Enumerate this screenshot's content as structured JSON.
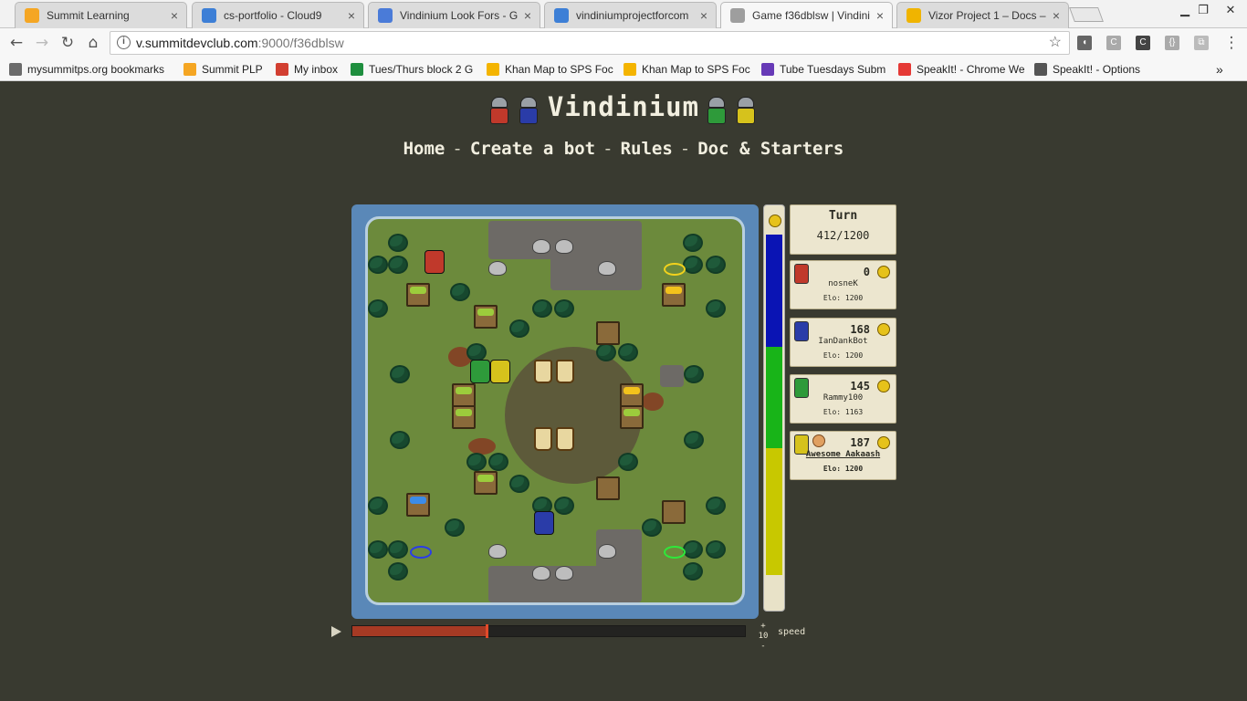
{
  "browser": {
    "tabs": [
      {
        "title": "Summit Learning",
        "icon": "sun-icon",
        "color": "#f5a623"
      },
      {
        "title": "cs-portfolio - Cloud9",
        "icon": "cloud9-icon",
        "color": "#3d7fd6"
      },
      {
        "title": "Vindinium Look Fors - Go",
        "icon": "google-docs-icon",
        "color": "#4a7bd8"
      },
      {
        "title": "vindiniumprojectforcom",
        "icon": "cloud9-icon",
        "color": "#3d7fd6"
      },
      {
        "title": "Game f36dblsw | Vindini",
        "icon": "page-icon",
        "color": "#9e9e9e"
      },
      {
        "title": "Vizor Project 1 – Docs –",
        "icon": "vizor-icon",
        "color": "#f0b400"
      }
    ],
    "close_glyph": "×",
    "url_host": "v.summitdevclub.com",
    "url_rest": ":9000/f36dblsw",
    "bookmarks": [
      {
        "label": "mysummitps.org bookmarks",
        "icon": "folder-icon",
        "color": "#6b6b6b"
      },
      {
        "label": "Summit PLP",
        "icon": "sun-icon",
        "color": "#f5a623"
      },
      {
        "label": "My inbox",
        "icon": "gmail-icon",
        "color": "#d23f31"
      },
      {
        "label": "Tues/Thurs block 2 G",
        "icon": "sheets-icon",
        "color": "#1e8e3e"
      },
      {
        "label": "Khan Map to SPS Foc",
        "icon": "drive-icon",
        "color": "#f4b400"
      },
      {
        "label": "Khan Map to SPS Foc",
        "icon": "drive-icon",
        "color": "#f4b400"
      },
      {
        "label": "Tube Tuesdays Subm",
        "icon": "forms-icon",
        "color": "#673ab7"
      },
      {
        "label": "SpeakIt! - Chrome We",
        "icon": "webstore-icon",
        "color": "#e53935"
      },
      {
        "label": "SpeakIt! - Options",
        "icon": "speaker-icon",
        "color": "#555555"
      }
    ],
    "more_bookmarks": "»"
  },
  "site": {
    "title": "Vindinium",
    "nav": [
      "Home",
      "Create a bot",
      "Rules",
      "Doc & Starters"
    ],
    "nav_sep": "-"
  },
  "game": {
    "turn_label": "Turn",
    "turn": "412/1200",
    "turn_fraction": 0.343,
    "players": [
      {
        "name": "nosneK",
        "gold": "0",
        "elo": "Elo: 1200",
        "color": "#c0392b",
        "icon": "crashed-bot-icon",
        "leader": false
      },
      {
        "name": "IanDankBot",
        "gold": "168",
        "elo": "Elo: 1200",
        "color": "#2a3ca8",
        "icon": "blue-hero-icon",
        "leader": false
      },
      {
        "name": "Rammy100",
        "gold": "145",
        "elo": "Elo: 1163",
        "color": "#2e9a3a",
        "icon": "green-hero-icon",
        "leader": false
      },
      {
        "name": "Awesome Aakaash",
        "gold": "187",
        "elo": "Elo: 1200",
        "color": "#d6c21c",
        "icon": "yellow-hero-icon",
        "leader": true
      }
    ],
    "gold_share": [
      {
        "color": "#0a14b4",
        "fraction": 0.3
      },
      {
        "color": "#18b418",
        "fraction": 0.27
      },
      {
        "color": "#c8c800",
        "fraction": 0.34
      }
    ],
    "speed": "10",
    "speed_up": "+",
    "speed_down": "-",
    "speed_label": "speed"
  }
}
